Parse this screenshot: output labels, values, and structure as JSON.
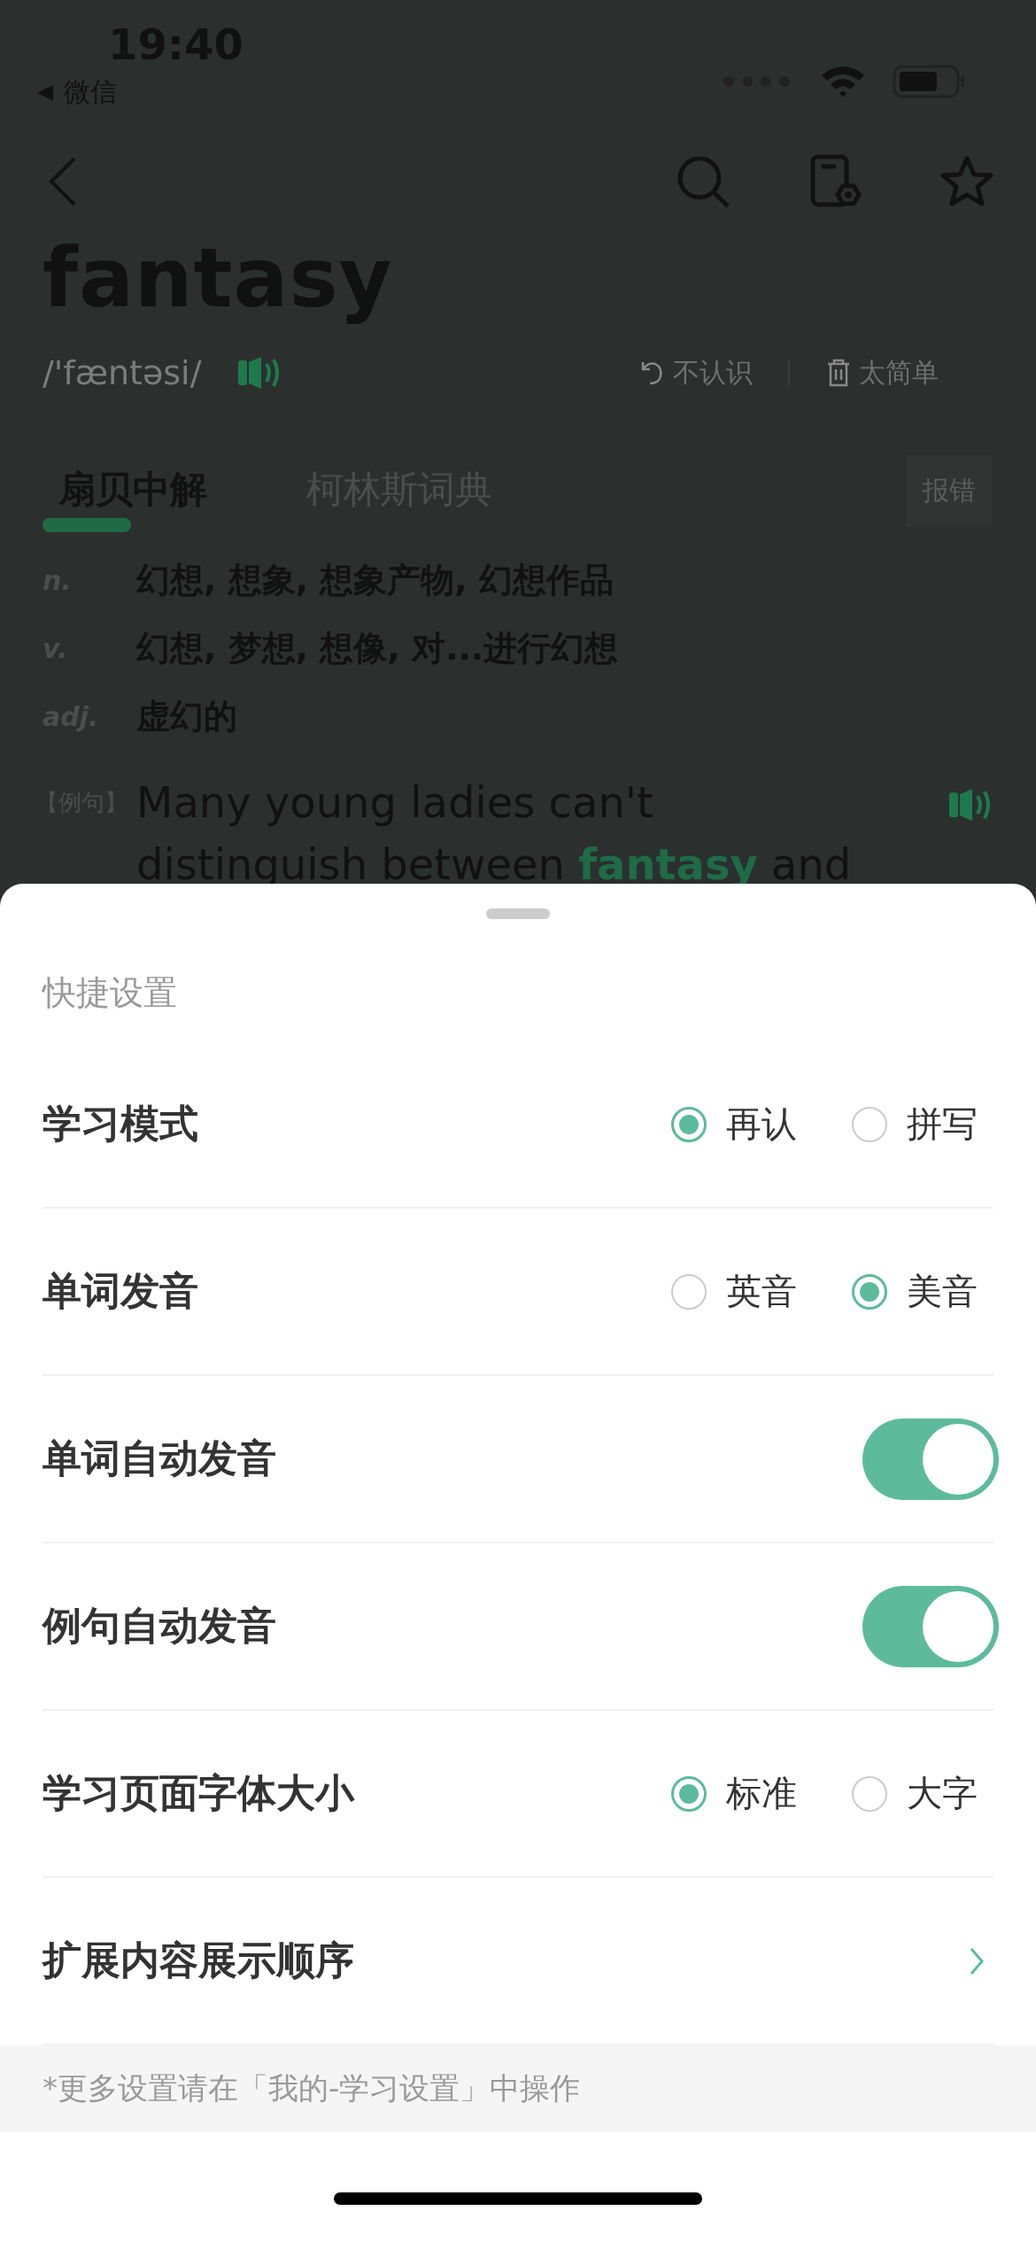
{
  "status_bar": {
    "time": "19:40",
    "back_app": "微信"
  },
  "word": {
    "title": "fantasy",
    "phonetic": "/'fæntəsi/"
  },
  "actions": [
    {
      "kind": "undo",
      "label": "不认识"
    },
    {
      "kind": "trash",
      "label": "太简单"
    }
  ],
  "tabs": [
    {
      "label": "扇贝中解",
      "selected": true
    },
    {
      "label": "柯林斯词典",
      "selected": false
    }
  ],
  "report": "报错",
  "definitions": [
    {
      "pos": "n.",
      "meaning": "幻想, 想象, 想象产物, 幻想作品"
    },
    {
      "pos": "v.",
      "meaning": "幻想, 梦想, 想像, 对...进行幻想"
    },
    {
      "pos": "adj.",
      "meaning": "虚幻的"
    }
  ],
  "example": {
    "tag": "【例句】",
    "lines": [
      "Many young ladies can't",
      "distinguish between **fantasy** and"
    ]
  },
  "sheet": {
    "title": "快捷设置",
    "rows": [
      {
        "kind": "radio",
        "label": "学习模式",
        "options": [
          {
            "label": "再认",
            "selected": true
          },
          {
            "label": "拼写",
            "selected": false
          }
        ]
      },
      {
        "kind": "radio",
        "label": "单词发音",
        "options": [
          {
            "label": "英音",
            "selected": false
          },
          {
            "label": "美音",
            "selected": true
          }
        ]
      },
      {
        "kind": "toggle",
        "label": "单词自动发音",
        "on": true
      },
      {
        "kind": "toggle",
        "label": "例句自动发音",
        "on": true
      },
      {
        "kind": "radio",
        "label": "学习页面字体大小",
        "options": [
          {
            "label": "标准",
            "selected": true
          },
          {
            "label": "大字",
            "selected": false
          }
        ]
      },
      {
        "kind": "link",
        "label": "扩展内容展示顺序"
      }
    ],
    "footnote": "*更多设置请在「我的-学习设置」中操作"
  }
}
